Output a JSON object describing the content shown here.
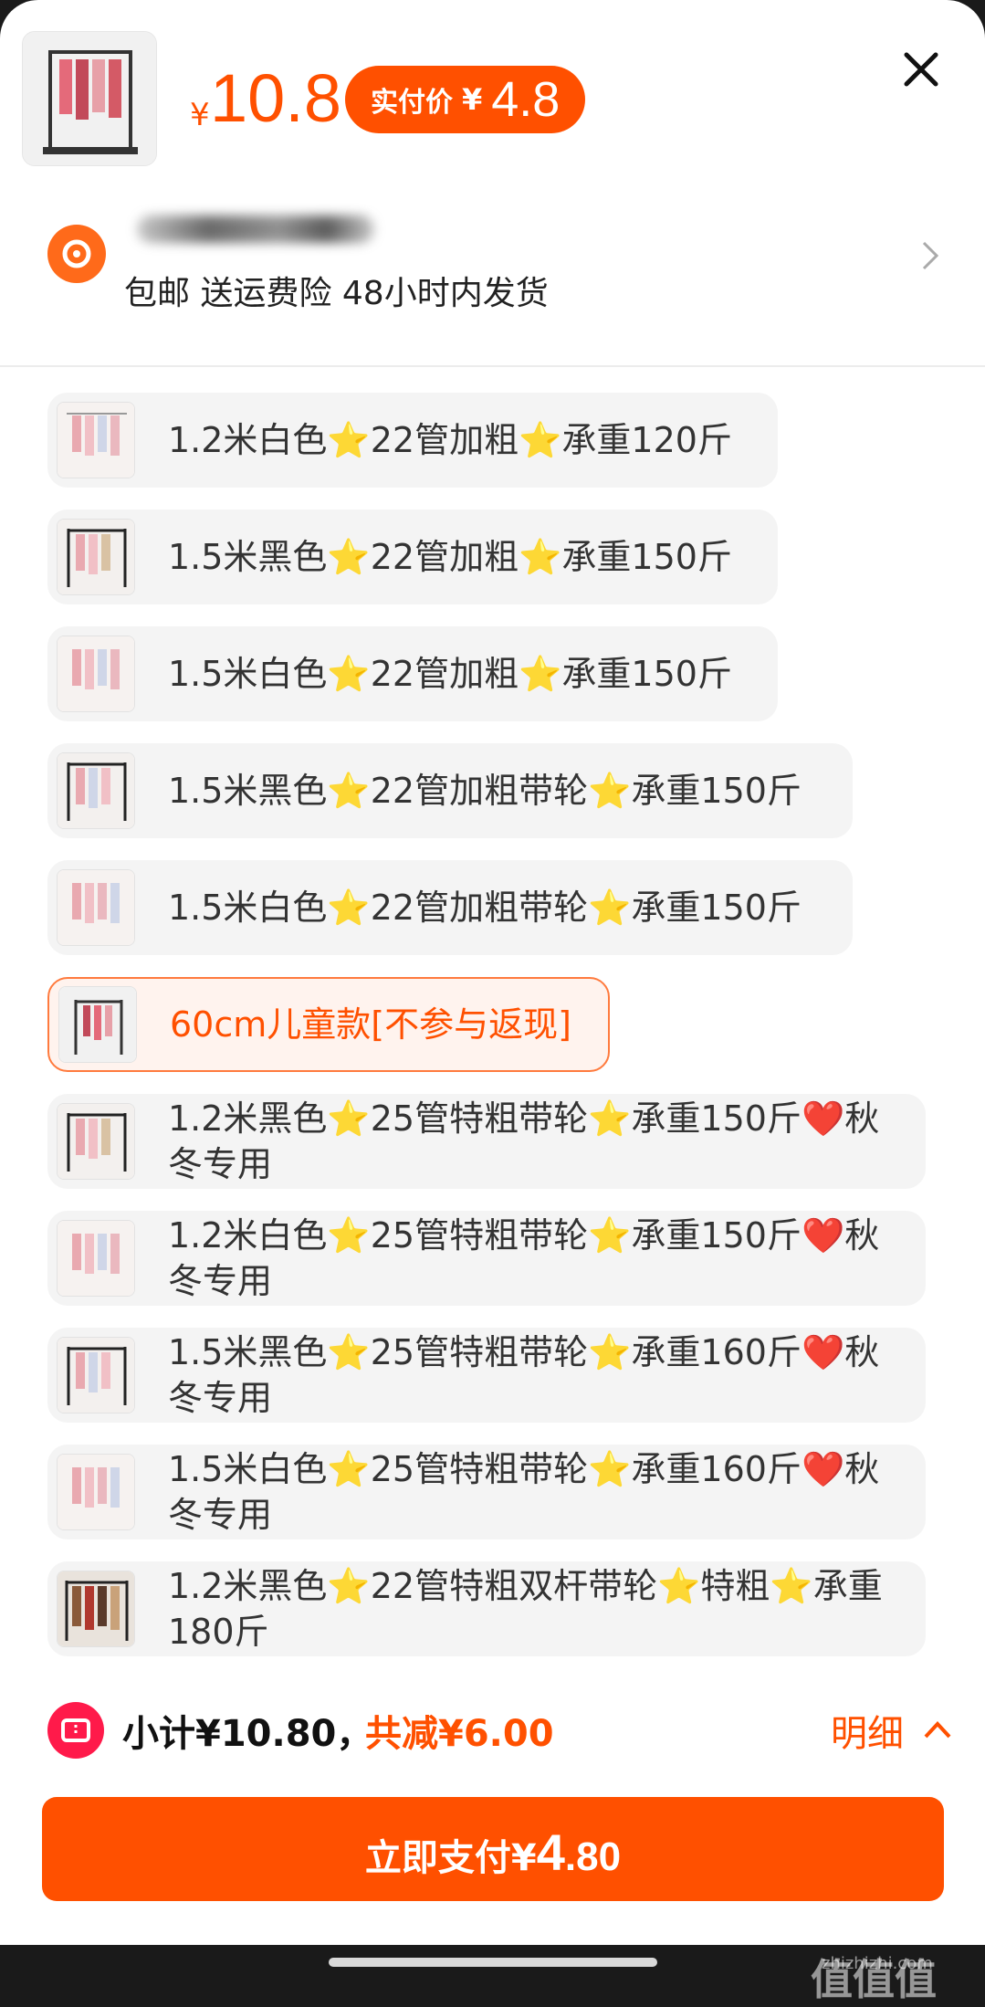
{
  "header": {
    "currency": "¥",
    "price": "10.8",
    "pay_label": "实付价",
    "pay_currency": "¥",
    "pay_value": "4.8"
  },
  "shipping": {
    "info": "包邮 送运费险 48小时内发货"
  },
  "options": [
    {
      "label": "1.2米白色⭐22管加粗⭐承重120斤",
      "selected": false
    },
    {
      "label": "1.5米黑色⭐22管加粗⭐承重150斤",
      "selected": false
    },
    {
      "label": "1.5米白色⭐22管加粗⭐承重150斤",
      "selected": false
    },
    {
      "label": "1.5米黑色⭐22管加粗带轮⭐承重150斤",
      "selected": false
    },
    {
      "label": "1.5米白色⭐22管加粗带轮⭐承重150斤",
      "selected": false
    },
    {
      "label": "60cm儿童款[不参与返现]",
      "selected": true
    },
    {
      "label": "1.2米黑色⭐25管特粗带轮⭐承重150斤❤️秋冬专用",
      "selected": false
    },
    {
      "label": "1.2米白色⭐25管特粗带轮⭐承重150斤❤️秋冬专用",
      "selected": false
    },
    {
      "label": "1.5米黑色⭐25管特粗带轮⭐承重160斤❤️秋冬专用",
      "selected": false
    },
    {
      "label": "1.5米白色⭐25管特粗带轮⭐承重160斤❤️秋冬专用",
      "selected": false
    },
    {
      "label": "1.2米黑色⭐22管特粗双杆带轮⭐特粗⭐承重180斤",
      "selected": false
    }
  ],
  "footer": {
    "subtotal": "小计¥10.80，",
    "saved": "共减¥6.00",
    "detail": "明细",
    "pay_prefix": "立即支付¥",
    "pay_int": "4",
    "pay_dec": ".80"
  },
  "watermark": {
    "text": "值值值",
    "site": "zhizhizhi.com"
  },
  "colors": {
    "accent": "#ff5000",
    "coupon": "#ff1a4a"
  }
}
